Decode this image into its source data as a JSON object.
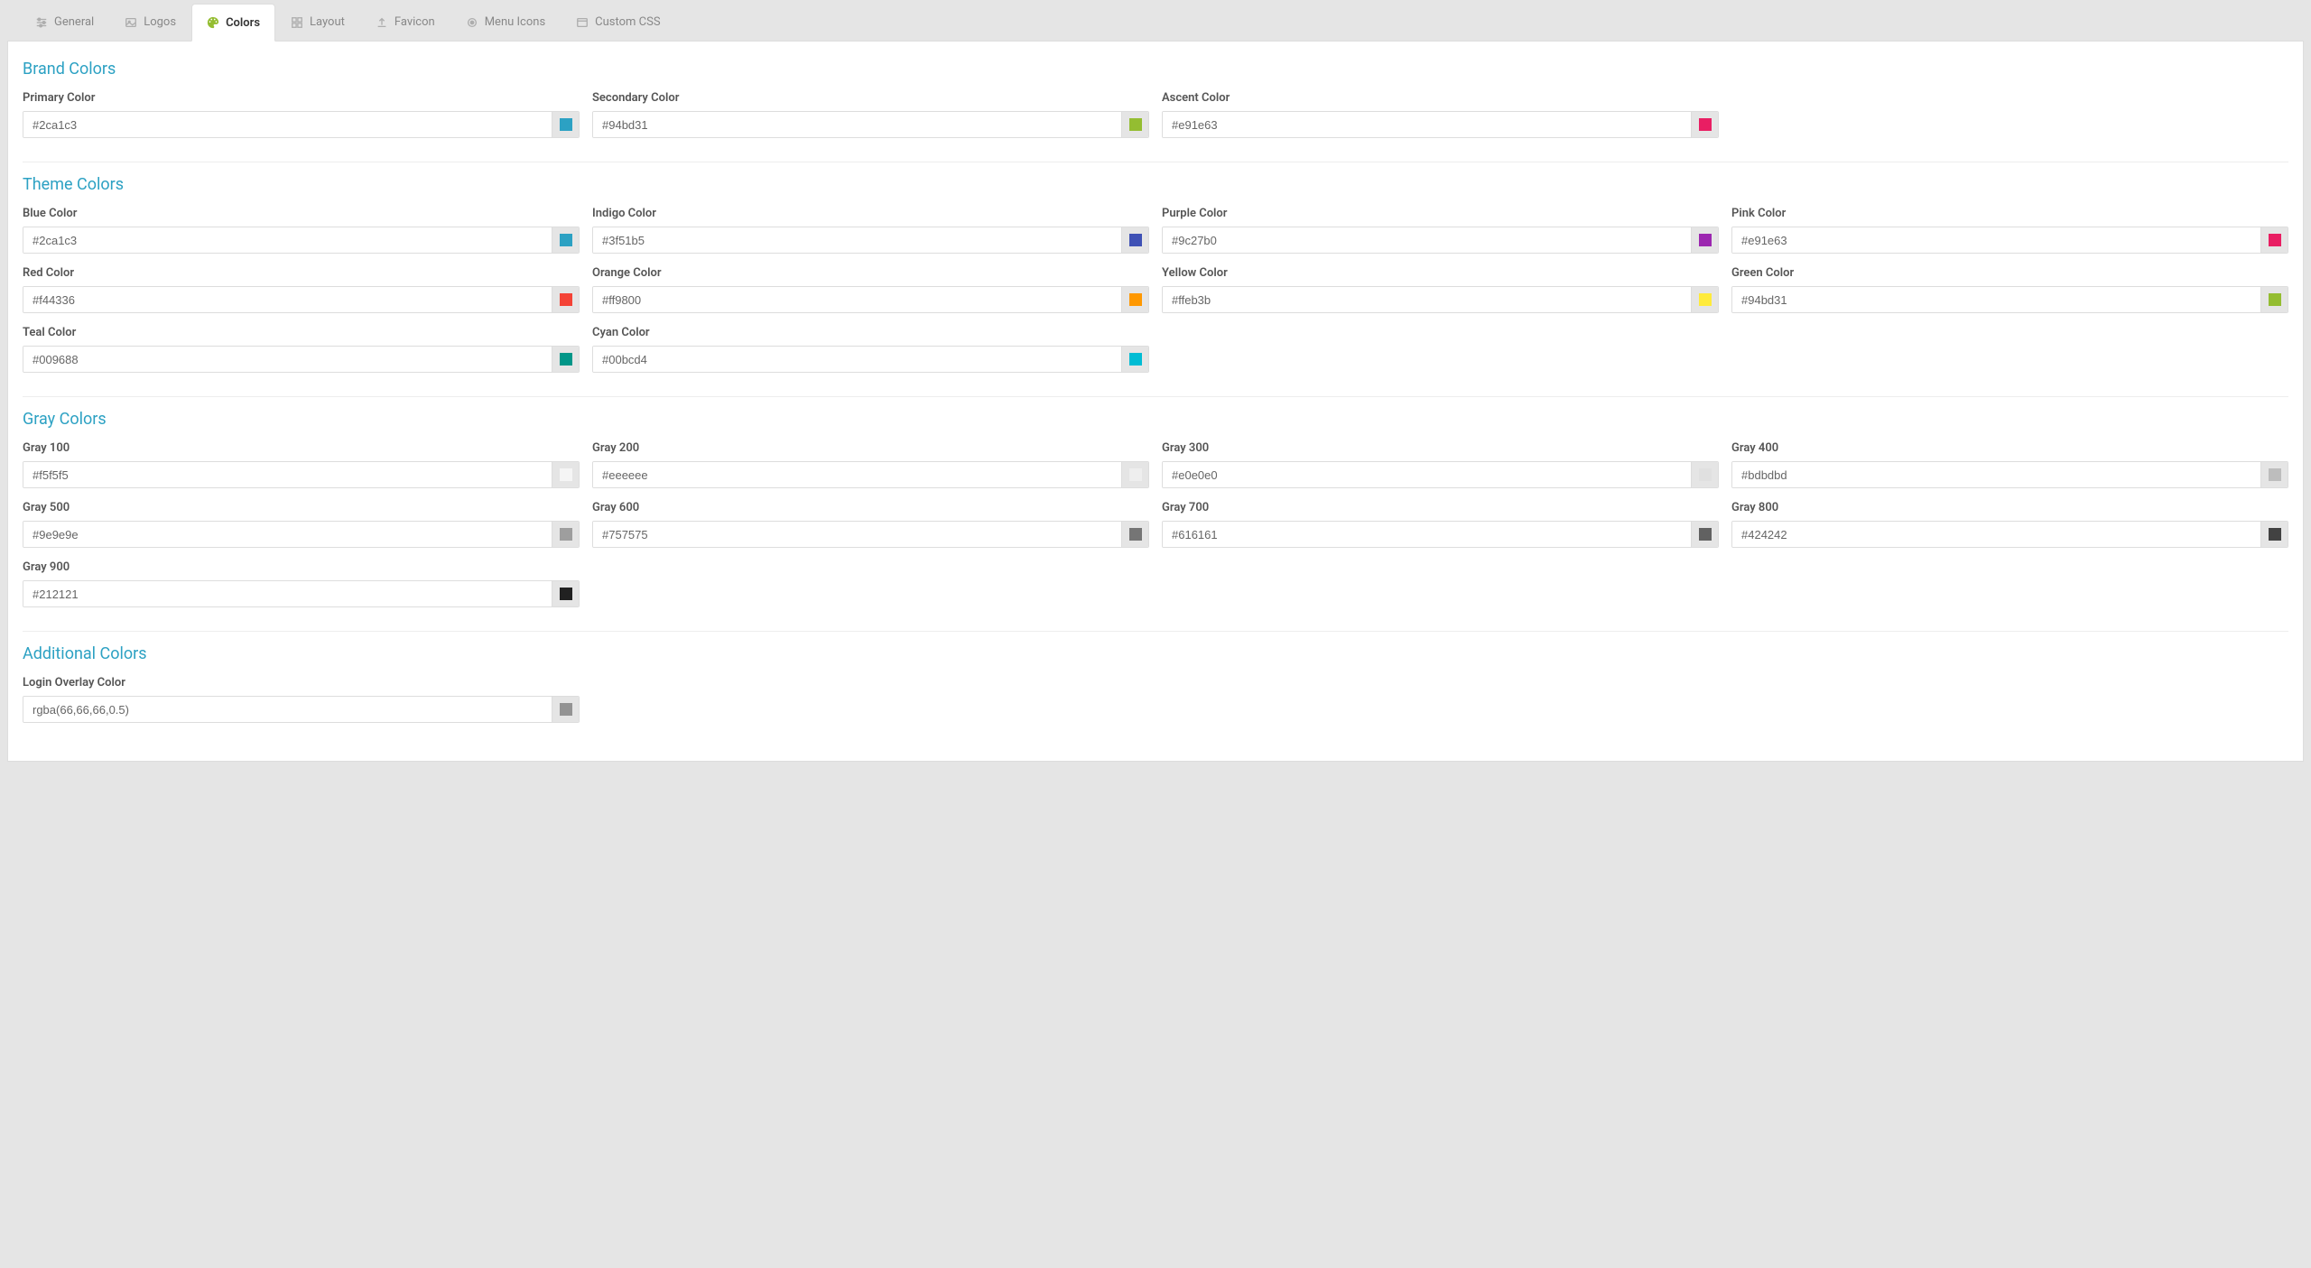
{
  "tabs": [
    {
      "id": "general",
      "label": "General"
    },
    {
      "id": "logos",
      "label": "Logos"
    },
    {
      "id": "colors",
      "label": "Colors"
    },
    {
      "id": "layout",
      "label": "Layout"
    },
    {
      "id": "favicon",
      "label": "Favicon"
    },
    {
      "id": "menuicons",
      "label": "Menu Icons"
    },
    {
      "id": "customcss",
      "label": "Custom CSS"
    }
  ],
  "sections": {
    "brand": {
      "title": "Brand Colors",
      "fields": [
        {
          "label": "Primary Color",
          "value": "#2ca1c3",
          "swatch": "#2ca1c3"
        },
        {
          "label": "Secondary Color",
          "value": "#94bd31",
          "swatch": "#94bd31"
        },
        {
          "label": "Ascent Color",
          "value": "#e91e63",
          "swatch": "#e91e63"
        }
      ]
    },
    "theme": {
      "title": "Theme Colors",
      "fields": [
        {
          "label": "Blue Color",
          "value": "#2ca1c3",
          "swatch": "#2ca1c3"
        },
        {
          "label": "Indigo Color",
          "value": "#3f51b5",
          "swatch": "#3f51b5"
        },
        {
          "label": "Purple Color",
          "value": "#9c27b0",
          "swatch": "#9c27b0"
        },
        {
          "label": "Pink Color",
          "value": "#e91e63",
          "swatch": "#e91e63"
        },
        {
          "label": "Red Color",
          "value": "#f44336",
          "swatch": "#f44336"
        },
        {
          "label": "Orange Color",
          "value": "#ff9800",
          "swatch": "#ff9800"
        },
        {
          "label": "Yellow Color",
          "value": "#ffeb3b",
          "swatch": "#ffeb3b"
        },
        {
          "label": "Green Color",
          "value": "#94bd31",
          "swatch": "#94bd31"
        },
        {
          "label": "Teal Color",
          "value": "#009688",
          "swatch": "#009688"
        },
        {
          "label": "Cyan Color",
          "value": "#00bcd4",
          "swatch": "#00bcd4"
        }
      ]
    },
    "gray": {
      "title": "Gray Colors",
      "fields": [
        {
          "label": "Gray 100",
          "value": "#f5f5f5",
          "swatch": "#f5f5f5"
        },
        {
          "label": "Gray 200",
          "value": "#eeeeee",
          "swatch": "#eeeeee"
        },
        {
          "label": "Gray 300",
          "value": "#e0e0e0",
          "swatch": "#e0e0e0"
        },
        {
          "label": "Gray 400",
          "value": "#bdbdbd",
          "swatch": "#bdbdbd"
        },
        {
          "label": "Gray 500",
          "value": "#9e9e9e",
          "swatch": "#9e9e9e"
        },
        {
          "label": "Gray 600",
          "value": "#757575",
          "swatch": "#757575"
        },
        {
          "label": "Gray 700",
          "value": "#616161",
          "swatch": "#616161"
        },
        {
          "label": "Gray 800",
          "value": "#424242",
          "swatch": "#424242"
        },
        {
          "label": "Gray 900",
          "value": "#212121",
          "swatch": "#212121"
        }
      ]
    },
    "additional": {
      "title": "Additional Colors",
      "fields": [
        {
          "label": "Login Overlay Color",
          "value": "rgba(66,66,66,0.5)",
          "swatch": "rgba(66,66,66,0.5)"
        }
      ]
    }
  }
}
